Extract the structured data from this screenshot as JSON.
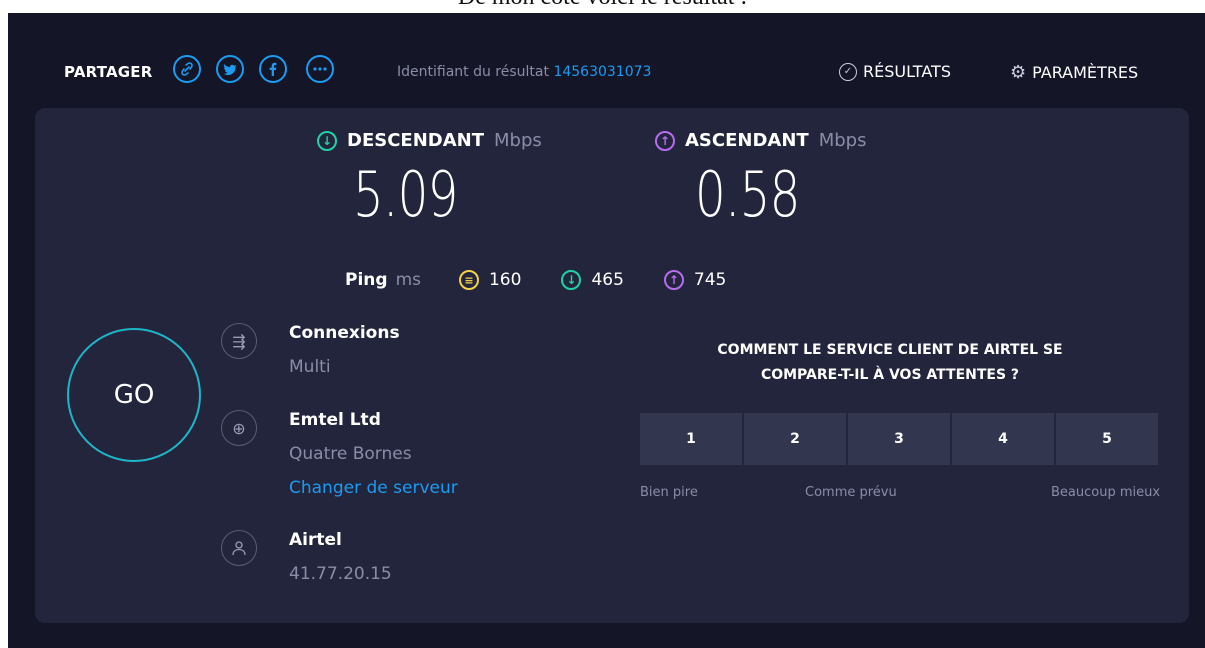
{
  "caption": "De mon côté voici le résultat :",
  "share": {
    "label": "PARTAGER",
    "icons": [
      "link-icon",
      "twitter-icon",
      "facebook-icon",
      "more-icon"
    ]
  },
  "result": {
    "label": "Identifiant du résultat",
    "id": "14563031073"
  },
  "nav": {
    "results": "RÉSULTATS",
    "settings": "PARAMÈTRES"
  },
  "download": {
    "label": "DESCENDANT",
    "unit": "Mbps",
    "value": "5.09",
    "color": "#1fd1a4"
  },
  "upload": {
    "label": "ASCENDANT",
    "unit": "Mbps",
    "value": "0.58",
    "color": "#b76cf0"
  },
  "ping": {
    "label": "Ping",
    "unit": "ms",
    "idle": "160",
    "download": "465",
    "upload": "745",
    "idle_color": "#f2d14a"
  },
  "go_label": "GO",
  "connections": {
    "title": "Connexions",
    "value": "Multi"
  },
  "server": {
    "title": "Emtel Ltd",
    "location": "Quatre Bornes",
    "change_link": "Changer de serveur"
  },
  "provider": {
    "title": "Airtel",
    "ip": "41.77.20.15"
  },
  "survey": {
    "question_line1": "COMMENT LE SERVICE CLIENT DE AIRTEL SE",
    "question_line2": "COMPARE-T-IL À VOS ATTENTES ?",
    "options": [
      "1",
      "2",
      "3",
      "4",
      "5"
    ],
    "low_label": "Bien pire",
    "mid_label": "Comme prévu",
    "high_label": "Beaucoup mieux"
  },
  "colors": {
    "accent": "#1c9bf0",
    "background": "#141526",
    "panel": "#23253c",
    "go_ring": "#1fb5c9"
  }
}
